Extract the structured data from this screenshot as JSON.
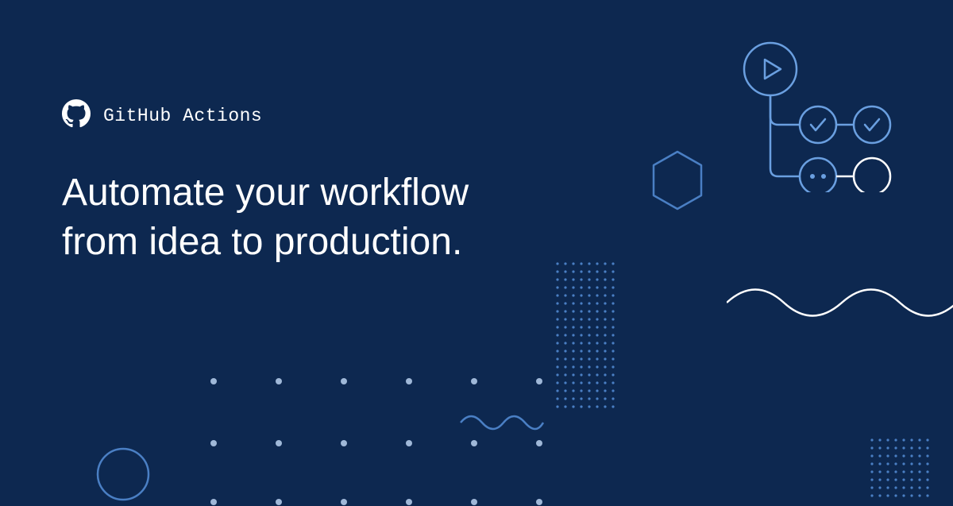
{
  "brand": {
    "label": "GitHub Actions"
  },
  "headline": {
    "line1": "Automate your workflow",
    "line2": "from idea to production."
  },
  "colors": {
    "background": "#0d2850",
    "text": "#ffffff",
    "accent_blue": "#4a7fc4",
    "pale_blue": "#9fb8d8"
  }
}
